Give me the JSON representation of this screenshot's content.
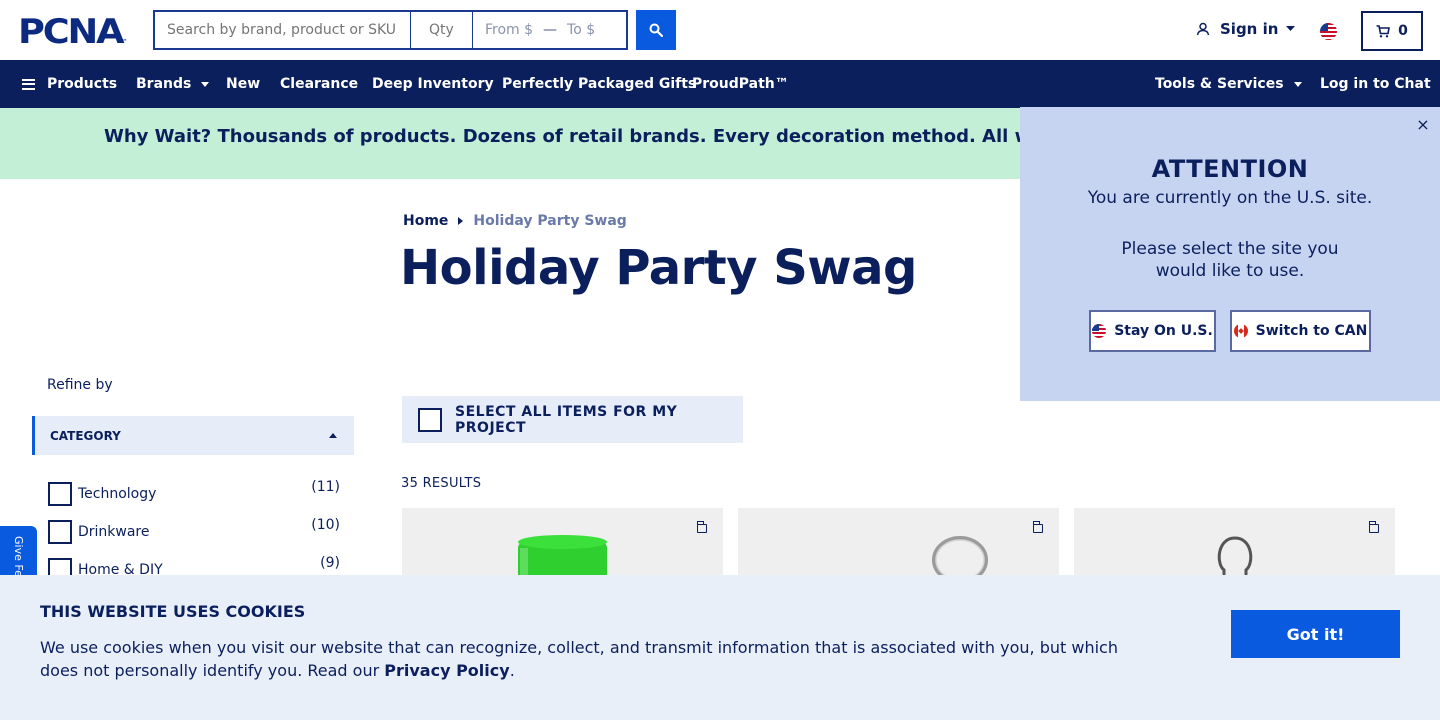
{
  "header": {
    "logo": "PCNA",
    "logo_tm": "™",
    "search_placeholder": "Search by brand, product or SKU",
    "qty_placeholder": "Qty",
    "price_from": "From $",
    "price_dash": "—",
    "price_to": "To $",
    "sign_in": "Sign in",
    "cart_count": "0"
  },
  "nav": {
    "products": "Products",
    "brands": "Brands",
    "new": "New",
    "clearance": "Clearance",
    "deep_inventory": "Deep Inventory",
    "gifts": "Perfectly Packaged Gifts",
    "proudpath": "ProudPath™",
    "tools": "Tools & Services",
    "chat": "Log in to Chat"
  },
  "banner": {
    "text": "Why Wait? Thousands of products. Dozens of retail brands. Every decoration method. All with a standard"
  },
  "breadcrumb": {
    "home": "Home",
    "current": "Holiday Party Swag"
  },
  "page": {
    "title": "Holiday Party Swag",
    "refine_by": "Refine by",
    "category_header": "CATEGORY",
    "select_all": "SELECT ALL ITEMS FOR MY PROJECT",
    "results": "35 RESULTS",
    "feedback": "Give Feedback"
  },
  "categories": [
    {
      "label": "Technology",
      "count": "(11)"
    },
    {
      "label": "Drinkware",
      "count": "(10)"
    },
    {
      "label": "Home & DIY",
      "count": "(9)"
    }
  ],
  "popup": {
    "close": "×",
    "title": "ATTENTION",
    "line1": "You are currently on the U.S. site.",
    "line2": "Please select the site you would like to use.",
    "stay_us": "Stay On U.S.",
    "switch_can": "Switch to CAN"
  },
  "cookie": {
    "title": "THIS WEBSITE USES COOKIES",
    "text_before": "We use cookies when you visit our website that can recognize, collect, and transmit information that is associated with you, but which does not personally identify you. Read our ",
    "privacy_link": "Privacy Policy",
    "text_after": ".",
    "button": "Got it!"
  },
  "colors": {
    "navy": "#0b1f5c",
    "brand_blue": "#0a5ae0",
    "banner_green": "#c2efd6",
    "popup_bg": "#c6d4f2",
    "cookie_bg": "#e9eff9"
  }
}
